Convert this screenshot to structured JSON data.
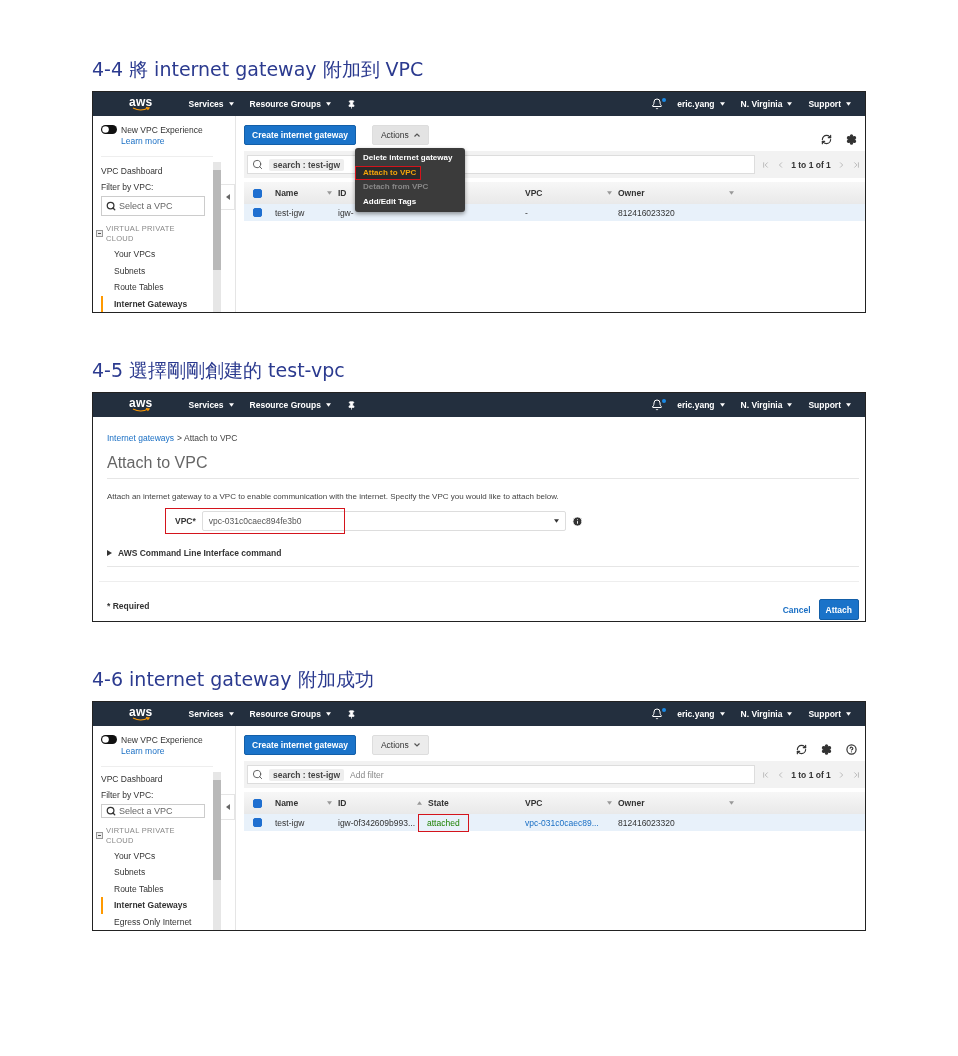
{
  "sections": [
    {
      "heading": "4-4 將 internet gateway 附加到 VPC",
      "screen": {
        "kind": "list",
        "navbar": {
          "logo": "aws",
          "menus": [
            "Services",
            "Resource Groups"
          ],
          "user": "eric.yang",
          "region": "N. Virginia",
          "support": "Support"
        },
        "sidebar": {
          "toggle_label": "New VPC Experience",
          "toggle_on": true,
          "learn_more": "Learn more",
          "dashboard": "VPC Dashboard",
          "filter_label": "Filter by VPC:",
          "filter_placeholder": "Select a VPC",
          "group": "VIRTUAL PRIVATE CLOUD",
          "items": [
            {
              "label": "Your VPCs",
              "selected": false
            },
            {
              "label": "Subnets",
              "selected": false
            },
            {
              "label": "Route Tables",
              "selected": false
            },
            {
              "label": "Internet Gateways",
              "selected": true
            }
          ]
        },
        "toolbar": {
          "create": "Create internet gateway",
          "actions": "Actions",
          "actions_expanded": true,
          "icons": [
            {
              "kind": "refresh"
            },
            {
              "kind": "settings"
            }
          ]
        },
        "menu": [
          {
            "label": "Delete internet gateway",
            "disabled": false,
            "highlight": false
          },
          {
            "label": "Attach to VPC",
            "disabled": false,
            "highlight": true
          },
          {
            "label": "Detach from VPC",
            "disabled": true,
            "highlight": false
          },
          {
            "label": "Add/Edit Tags",
            "disabled": false,
            "highlight": false
          }
        ],
        "search": {
          "token": "search : test-igw"
        },
        "pagination": "1 to 1 of 1",
        "all_selected": true,
        "columns": [
          {
            "label": "Name",
            "sortable": true,
            "sorted_ascending": false
          },
          {
            "label": "ID",
            "sortable": false,
            "wide": true
          },
          {
            "label": "VPC",
            "sortable": true,
            "sorted_ascending": false
          },
          {
            "label": "Owner",
            "sortable": true,
            "sorted_ascending": false
          }
        ],
        "rows": [
          {
            "selected": true,
            "cells": [
              {
                "text": "test-igw"
              },
              {
                "text": "igw-"
              },
              {
                "text": "-"
              },
              {
                "text": "812416023320"
              }
            ]
          }
        ]
      }
    },
    {
      "heading": "4-5 選擇剛剛創建的 test-vpc",
      "screen": {
        "kind": "form",
        "navbar": {
          "logo": "aws",
          "menus": [
            "Services",
            "Resource Groups"
          ],
          "user": "eric.yang",
          "region": "N. Virginia",
          "support": "Support"
        },
        "breadcrumb": {
          "link": "Internet gateways",
          "current": "> Attach to VPC"
        },
        "title": "Attach to VPC",
        "description": "Attach an internet gateway to a VPC to enable communication with the internet. Specify the VPC you would like to attach below.",
        "field": {
          "label": "VPC*",
          "value": "vpc-031c0caec894fe3b0",
          "highlight": true
        },
        "cli": {
          "label": "AWS Command Line Interface command",
          "expanded": false
        },
        "required": "* Required",
        "buttons": {
          "cancel": "Cancel",
          "attach": "Attach"
        }
      }
    },
    {
      "heading": "4-6 internet gateway 附加成功",
      "screen": {
        "kind": "list",
        "navbar": {
          "logo": "aws",
          "menus": [
            "Services",
            "Resource Groups"
          ],
          "user": "eric.yang",
          "region": "N. Virginia",
          "support": "Support"
        },
        "sidebar": {
          "toggle_label": "New VPC Experience",
          "toggle_on": true,
          "learn_more": "Learn more",
          "dashboard": "VPC Dashboard",
          "filter_label": "Filter by VPC:",
          "filter_placeholder": "Select a VPC",
          "group": "VIRTUAL PRIVATE CLOUD",
          "items": [
            {
              "label": "Your VPCs",
              "selected": false
            },
            {
              "label": "Subnets",
              "selected": false
            },
            {
              "label": "Route Tables",
              "selected": false
            },
            {
              "label": "Internet Gateways",
              "selected": true
            },
            {
              "label": "Egress Only Internet",
              "selected": false
            }
          ]
        },
        "toolbar": {
          "create": "Create internet gateway",
          "actions": "Actions",
          "actions_expanded": false,
          "icons": [
            {
              "kind": "refresh"
            },
            {
              "kind": "settings"
            },
            {
              "kind": "help"
            }
          ]
        },
        "search": {
          "token": "search : test-igw",
          "placeholder": "Add filter"
        },
        "pagination": "1 to 1 of 1",
        "all_selected": true,
        "columns": [
          {
            "label": "Name",
            "sortable": true,
            "sorted_ascending": false
          },
          {
            "label": "ID",
            "sortable": true,
            "sorted_ascending": true
          },
          {
            "label": "State",
            "sortable": false
          },
          {
            "label": "VPC",
            "sortable": true,
            "sorted_ascending": false
          },
          {
            "label": "Owner",
            "sortable": true,
            "sorted_ascending": false
          }
        ],
        "rows": [
          {
            "selected": true,
            "cells": [
              {
                "text": "test-igw"
              },
              {
                "text": "igw-0f342609b993..."
              },
              {
                "text": "attached",
                "success": true,
                "highlight": true
              },
              {
                "text": "vpc-031c0caec89...",
                "link": true
              },
              {
                "text": "812416023320"
              }
            ]
          }
        ]
      }
    }
  ]
}
